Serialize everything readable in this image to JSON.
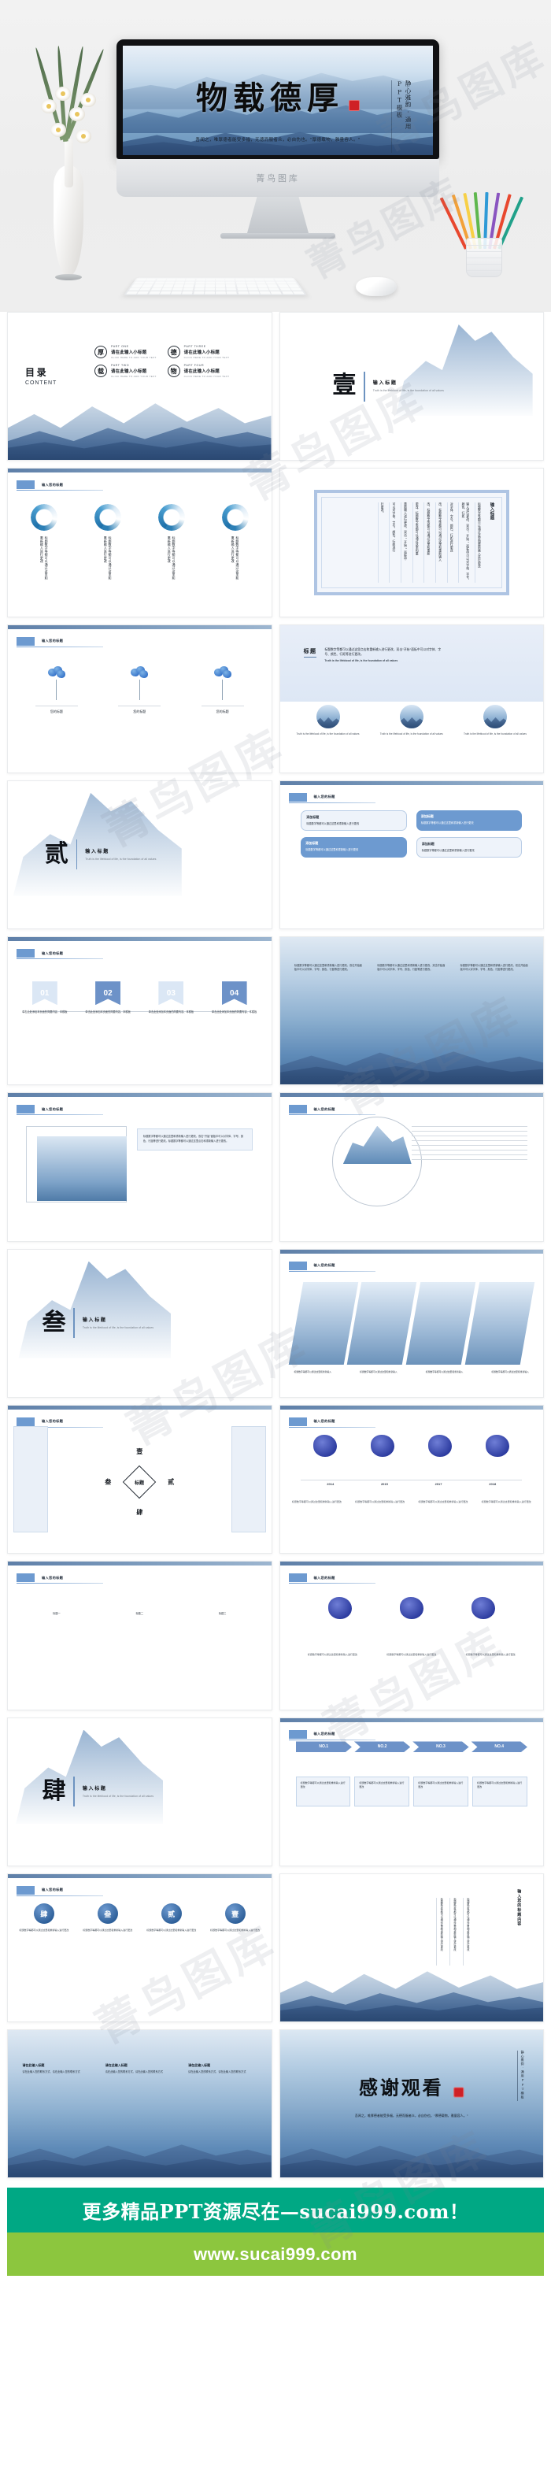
{
  "hero": {
    "title_chars": [
      "物",
      "载",
      "德",
      "厚"
    ],
    "stamp_label": "印章",
    "vertical_tag": "静心雅韵·通用PPT模板",
    "subtitle": "吾闻之，唯厚德者能受多福，无德而服者众，必自伤也。\"厚德载物，雅量容人。\"",
    "monitor_brand": "菁鸟图库"
  },
  "watermark": "菁鸟图库",
  "slides": [
    {
      "id": "toc",
      "title_zh": "目录",
      "title_en": "CONTENT",
      "items": [
        {
          "ring": "厚",
          "part": "PART ONE",
          "heading": "请在此输入小标题",
          "caption": "CLICK HERE TO ADD YOUR TEXT"
        },
        {
          "ring": "德",
          "part": "PART THREE",
          "heading": "请在此输入小标题",
          "caption": "CLICK HERE TO ADD YOUR TEXT"
        },
        {
          "ring": "载",
          "part": "PART TWO",
          "heading": "请在此输入小标题",
          "caption": "CLICK HERE TO ADD YOUR TEXT"
        },
        {
          "ring": "物",
          "part": "PART FOUR",
          "heading": "请在此输入小标题",
          "caption": "CLICK HERE TO ADD YOUR TEXT"
        }
      ]
    },
    {
      "id": "section-1",
      "number": "壹",
      "heading": "输入标题",
      "sub": "Truth is the lifeblood of life, is the foundation of all values"
    },
    {
      "id": "rings",
      "tag": "输入您的标题",
      "columns": [
        "标题数字等都可以通过这里和重新输入进行更改",
        "标题数字等都可以通过这里和重新输入进行更改",
        "标题数字等都可以通过这里和重新输入进行更改",
        "标题数字等都可以通过这里和重新输入进行更改"
      ]
    },
    {
      "id": "vertical-frame",
      "heading": "输入标题",
      "columns": [
        "标题数字等都可以通过这里和重新输入进行更改",
        "输入进行更改，双击\"开始\"面板中可以对字体、字号、颜色、行距",
        "对字体、字号、颜色、行距进行更改",
        "改，标题数字等都可以通过这里和重新输入",
        "改，标题数字等都可以通过这里和重新",
        "更改，标题数字等都可以通过这里和重",
        "重新输入进行更改，双击\"开始\"面板中",
        "可以对字体、字号、颜色、行距进行",
        "行更改。"
      ]
    },
    {
      "id": "flowers",
      "tag": "输入您的标题",
      "captions": [
        "您的标题",
        "您的标题",
        "您的标题"
      ]
    },
    {
      "id": "title-circles",
      "heading": "标题",
      "body_zh": "标题数字等都可以通过这里点击和重新输入进行更改，双击\"开始\"面板中可以对字体、字号、颜色、行距等进行更改。",
      "body_en": "Truth is the lifeblood of life, is the foundation of all values",
      "captions": [
        "Truth is the lifeblood of life, is the foundation of all values",
        "Truth is the lifeblood of life, is the foundation of all values",
        "Truth is the lifeblood of life, is the foundation of all values"
      ]
    },
    {
      "id": "section-2",
      "number": "贰",
      "heading": "输入标题",
      "sub": "Truth is the lifeblood of life, is the foundation of all values"
    },
    {
      "id": "round-boxes",
      "tag": "输入您的标题",
      "boxes": [
        {
          "style": "out",
          "h": "添加标题",
          "t": "标题数字等都可以通过这里和重新输入进行更改"
        },
        {
          "style": "fill",
          "h": "添加标题",
          "t": "标题数字等都可以通过这里和重新输入进行更改"
        },
        {
          "style": "fill",
          "h": "添加标题",
          "t": "标题数字等都可以通过这里和重新输入进行更改"
        },
        {
          "style": "out",
          "h": "添加标题",
          "t": "标题数字等都可以通过这里和重新输入进行更改"
        }
      ]
    },
    {
      "id": "ribbons",
      "tag": "输入您的标题",
      "ribbons": [
        {
          "n": "01",
          "tone": "lt",
          "cap": "单击此处添加本页面的简要内容、本模板"
        },
        {
          "n": "02",
          "tone": "dk",
          "cap": "单击此处添加本页面的简要内容、本模板"
        },
        {
          "n": "03",
          "tone": "lt",
          "cap": "单击此处添加本页面的简要内容、本模板"
        },
        {
          "n": "04",
          "tone": "dk",
          "cap": "单击此处添加本页面的简要内容、本模板"
        }
      ]
    },
    {
      "id": "three-cols-mountain",
      "columns": [
        "标题数字等都可以通过这里和重新输入进行更改，双击开始面板中可以对字体、字号、颜色、行距等进行更改。",
        "标题数字等都可以通过这里和重新输入进行更改，双击开始面板中可以对字体、字号、颜色、行距等进行更改。",
        "标题数字等都可以通过这里和重新输入进行更改，双击开始面板中可以对字体、字号、颜色、行距等进行更改。"
      ]
    },
    {
      "id": "frame-paragraph",
      "tag": "输入您的标题",
      "paragraph": "标题数字等都可以通过这里和重新输入进行更改，双击\"开始\"面板中可以对字体、字号、颜色、行距等进行更改。标题数字等都可以通过这里点击和重新输入进行更改。"
    },
    {
      "id": "circle-lines",
      "tag": "输入您的标题",
      "lines": 8
    },
    {
      "id": "section-3",
      "number": "叁",
      "heading": "输入标题",
      "sub": "Truth is the lifeblood of life, is the foundation of all values"
    },
    {
      "id": "parallelograms",
      "tag": "输入您的标题",
      "captions": [
        "标题数字等都可以通过这里和重新输入",
        "标题数字等都可以通过这里和重新输入",
        "标题数字等都可以通过这里和重新输入",
        "标题数字等都可以通过这里和重新输入"
      ]
    },
    {
      "id": "diamond",
      "tag": "输入您的标题",
      "center": "标题",
      "numerals": [
        "壹",
        "贰",
        "叁",
        "肆"
      ]
    },
    {
      "id": "splats",
      "tag": "输入您的标题",
      "years": [
        "2014",
        "2015",
        "2017",
        "2018"
      ],
      "captions": [
        "标题数字等都可以通过这里和重新输入进行更改",
        "标题数字等都可以通过这里和重新输入进行更改",
        "标题数字等都可以通过这里和重新输入进行更改",
        "标题数字等都可以通过这里和重新输入进行更改"
      ]
    },
    {
      "id": "three-text",
      "tag": "输入您的标题",
      "headings": [
        "标题一",
        "标题二",
        "标题三"
      ]
    },
    {
      "id": "splats-2",
      "tag": "输入您的标题",
      "captions": [
        "标题数字等都可以通过这里和重新输入进行更改",
        "标题数字等都可以通过这里和重新输入进行更改",
        "标题数字等都可以通过这里和重新输入进行更改"
      ]
    },
    {
      "id": "section-4",
      "number": "肆",
      "heading": "输入标题",
      "sub": "Truth is the lifeblood of life, is the foundation of all values"
    },
    {
      "id": "chevrons",
      "tag": "输入您的标题",
      "steps": [
        "NO.1",
        "NO.2",
        "NO.3",
        "NO.4"
      ],
      "boxes": [
        "标题数字等都可以通过这里和重新输入进行更改",
        "标题数字等都可以通过这里和重新输入进行更改",
        "标题数字等都可以通过这里和重新输入进行更改",
        "标题数字等都可以通过这里和重新输入进行更改"
      ]
    },
    {
      "id": "seal-badges",
      "tag": "输入您的标题",
      "badges": [
        "肆",
        "叁",
        "贰",
        "壹"
      ],
      "captions": [
        "标题数字等都可以通过这里和重新输入进行更改",
        "标题数字等都可以通过这里和重新输入进行更改",
        "标题数字等都可以通过这里和重新输入进行更改",
        "标题数字等都可以通过这里和重新输入进行更改"
      ]
    },
    {
      "id": "vertical-mountain",
      "heading": "输入您的标题内容",
      "columns": [
        "标题数字等都可以通过这里和重新输入进行更改",
        "标题数字等都可以通过这里和重新输入进行更改",
        "标题数字等都可以通过这里和重新输入进行更改"
      ]
    },
    {
      "id": "contact",
      "blocks": [
        {
          "h": "请在此输入标题",
          "t": "请在此输入您的联系方式、请在此输入您的联系方式"
        },
        {
          "h": "请在此输入标题",
          "t": "请在此输入您的联系方式、请在此输入您的联系方式"
        },
        {
          "h": "请在此输入标题",
          "t": "请在此输入您的联系方式、请在此输入您的联系方式"
        }
      ]
    },
    {
      "id": "thanks",
      "title": "感谢观看",
      "stamp_label": "印章",
      "vertical_tag": "静心雅韵·通用PPT模板",
      "subtitle": "吾闻之，唯厚德者能受多福，无德而服者众，必自伤也。\"厚德载物，雅量容人。\""
    }
  ],
  "footer": {
    "banner_primary": "更多精品PPT资源尽在—sucai999.com！",
    "banner_secondary": "www.sucai999.com",
    "color_primary": "#00a884",
    "color_secondary": "#8cc63e"
  }
}
